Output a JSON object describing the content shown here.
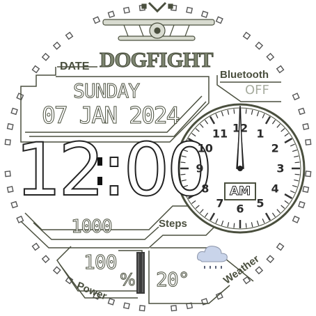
{
  "watch": {
    "title": "DOGFIGHT",
    "date_label": "DATE",
    "day": "SUNDAY",
    "date": "07 JAN 2024",
    "time": "12:00",
    "ampm": "AM",
    "bluetooth": {
      "label": "Bluetooth",
      "state": "OFF"
    },
    "steps": {
      "value": "1000",
      "label": "Steps"
    },
    "battery": {
      "value": "100",
      "unit": "%",
      "label": "Power"
    },
    "weather": {
      "temperature": "20°",
      "label": "Weather",
      "icon": "rain-cloud-icon"
    },
    "dial_numbers": [
      "12",
      "1",
      "2",
      "3",
      "4",
      "5",
      "6",
      "7",
      "8",
      "9",
      "10",
      "11"
    ],
    "colors": {
      "ink": "#4a4f3e",
      "olive": "#7d8570",
      "accent": "#d3d6c8"
    }
  }
}
